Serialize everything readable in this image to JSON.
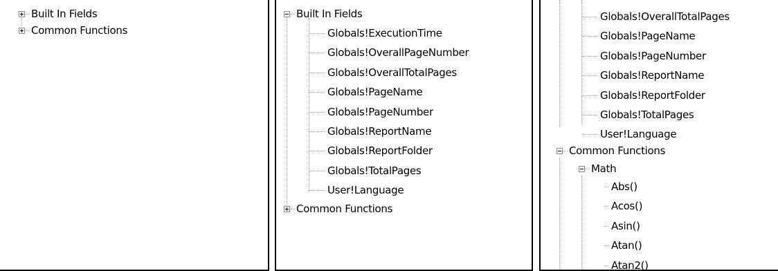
{
  "panel1": {
    "items": [
      {
        "label": "Built In Fields"
      },
      {
        "label": "Common Functions"
      }
    ]
  },
  "panel2": {
    "root1": "Built In Fields",
    "children": [
      "Globals!ExecutionTime",
      "Globals!OverallPageNumber",
      "Globals!OverallTotalPages",
      "Globals!PageName",
      "Globals!PageNumber",
      "Globals!ReportName",
      "Globals!ReportFolder",
      "Globals!TotalPages",
      "User!Language"
    ],
    "root2": "Common Functions"
  },
  "panel3": {
    "children": [
      "Globals!OverallTotalPages",
      "Globals!PageName",
      "Globals!PageNumber",
      "Globals!ReportName",
      "Globals!ReportFolder",
      "Globals!TotalPages",
      "User!Language"
    ],
    "root2": "Common Functions",
    "math": "Math",
    "math_children": [
      "Abs()",
      "Acos()",
      "Asin()",
      "Atan()",
      "Atan2()"
    ]
  }
}
